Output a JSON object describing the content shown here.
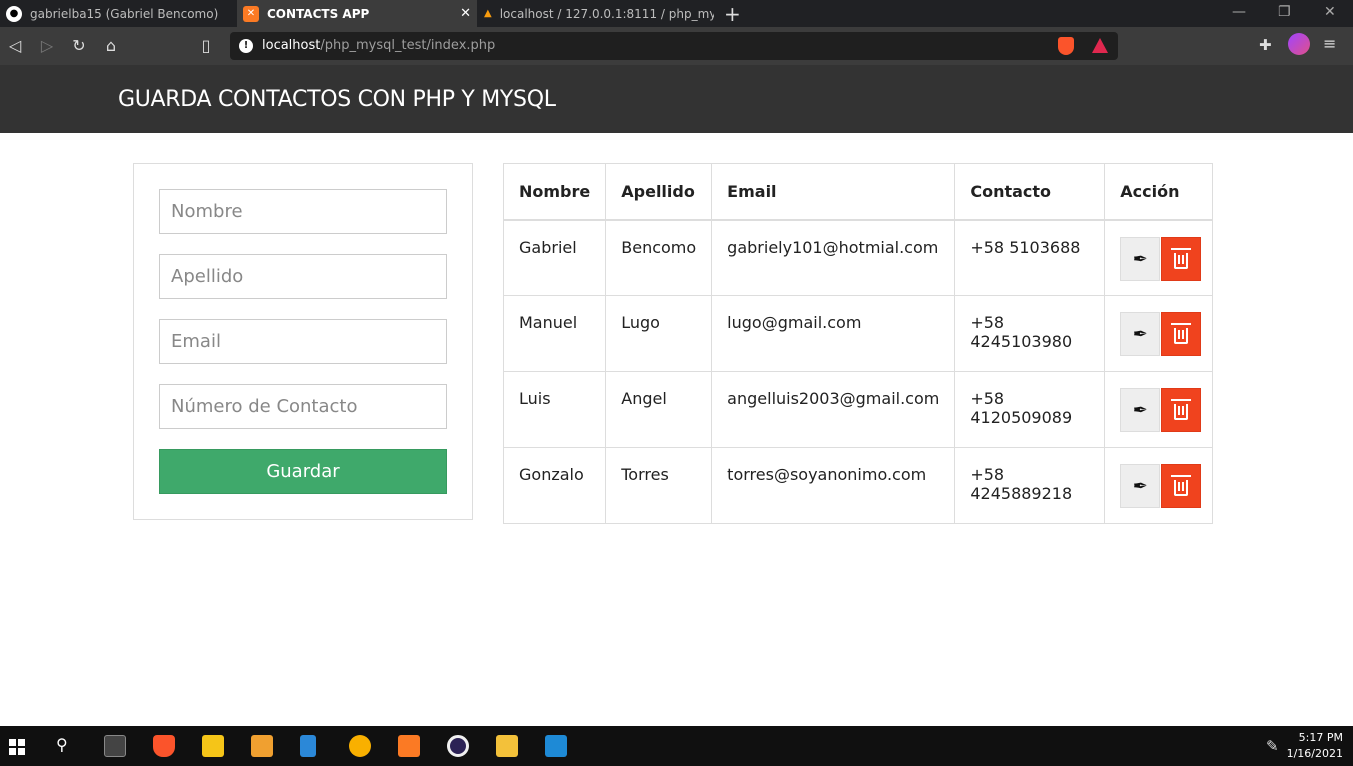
{
  "browser": {
    "tabs": [
      {
        "title": "gabrielba15 (Gabriel Bencomo)",
        "icon": "github-icon",
        "active": false
      },
      {
        "title": "CONTACTS APP",
        "icon": "xampp-icon",
        "active": true
      },
      {
        "title": "localhost / 127.0.0.1:8111 / php_mysq",
        "icon": "phpmyadmin-icon",
        "active": false
      }
    ],
    "new_tab": "+",
    "url_host": "localhost",
    "url_path": "/php_mysql_test/index.php"
  },
  "header": {
    "title": "GUARDA CONTACTOS CON PHP Y MYSQL"
  },
  "form": {
    "nombre_placeholder": "Nombre",
    "apellido_placeholder": "Apellido",
    "email_placeholder": "Email",
    "contacto_placeholder": "Número de Contacto",
    "save_label": "Guardar"
  },
  "table": {
    "headers": [
      "Nombre",
      "Apellido",
      "Email",
      "Contacto",
      "Acción"
    ],
    "rows": [
      {
        "nombre": "Gabriel",
        "apellido": "Bencomo",
        "email": "gabriely101@hotmial.com",
        "contacto": "+58 5103688"
      },
      {
        "nombre": "Manuel",
        "apellido": "Lugo",
        "email": "lugo@gmail.com",
        "contacto": "+58 4245103980"
      },
      {
        "nombre": "Luis",
        "apellido": "Angel",
        "email": "angelluis2003@gmail.com",
        "contacto": "+58 4120509089"
      },
      {
        "nombre": "Gonzalo",
        "apellido": "Torres",
        "email": "torres@soyanonimo.com",
        "contacto": "+58 4245889218"
      }
    ]
  },
  "taskbar": {
    "time": "5:17 PM",
    "date": "1/16/2021"
  },
  "colors": {
    "header_bg": "#333333",
    "save_button": "#3fa96b",
    "delete_button": "#f0431e"
  }
}
